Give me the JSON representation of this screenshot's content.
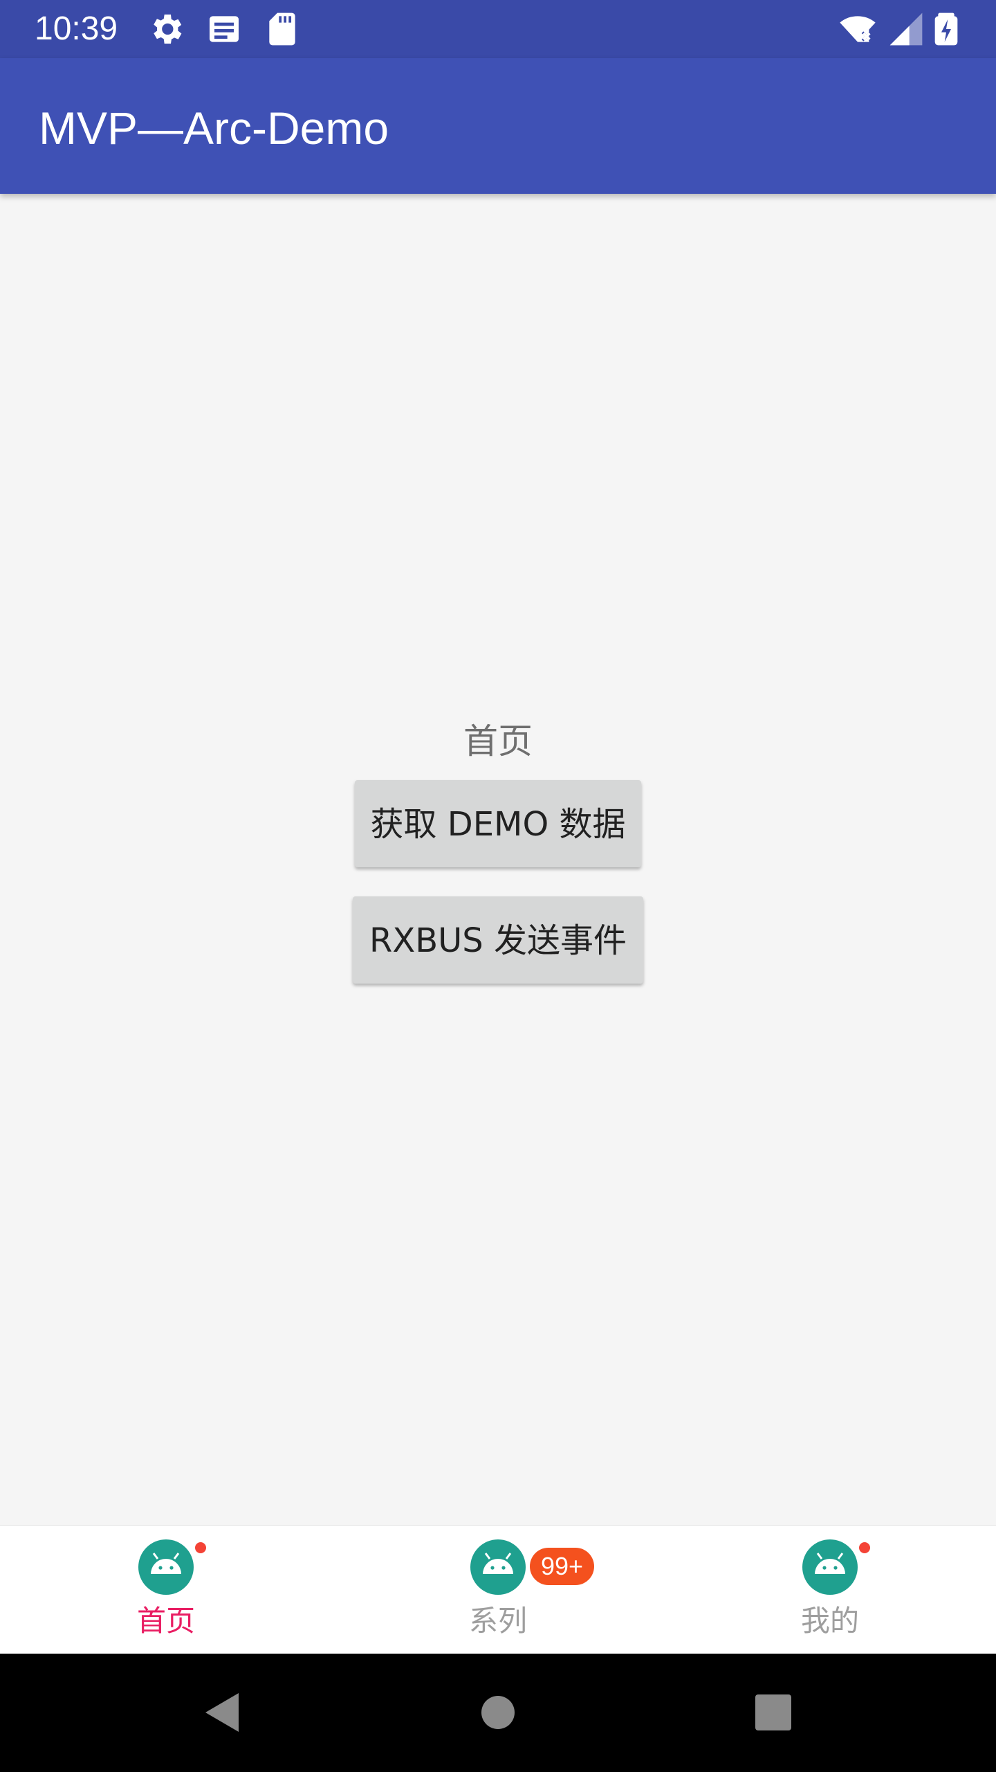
{
  "status_bar": {
    "time": "10:39",
    "icons": [
      "gear-icon",
      "news-icon",
      "sd-card-icon",
      "wifi-off-icon",
      "signal-icon",
      "battery-charging-icon"
    ]
  },
  "app_bar": {
    "title": "MVP—Arc-Demo"
  },
  "main": {
    "page_label": "首页",
    "fetch_button": "获取 DEMO 数据",
    "rxbus_button": "RXBUS 发送事件"
  },
  "bottom_nav": {
    "items": [
      {
        "label": "首页",
        "icon": "android-icon",
        "active": true,
        "indicator": "dot"
      },
      {
        "label": "系列",
        "icon": "android-icon",
        "active": false,
        "indicator": "badge",
        "badge": "99+"
      },
      {
        "label": "我的",
        "icon": "android-icon",
        "active": false,
        "indicator": "dot"
      }
    ]
  },
  "system_nav": {
    "icons": [
      "back-icon",
      "home-icon",
      "recents-icon"
    ]
  },
  "colors": {
    "primary": "#3f51b5",
    "primary_dark": "#3a4aa8",
    "accent_active": "#e91e63",
    "badge": "#f4511e",
    "icon_teal": "#1fa08f"
  }
}
